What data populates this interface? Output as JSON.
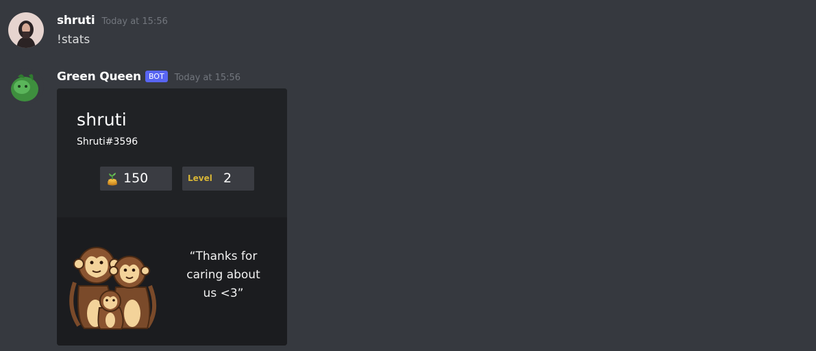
{
  "messages": [
    {
      "author": "shruti",
      "timestamp": "Today at 15:56",
      "content": "!stats"
    },
    {
      "author": "Green Queen",
      "bot_tag": "BOT",
      "timestamp": "Today at 15:56",
      "embed": {
        "name": "shruti",
        "tag": "Shruti#3596",
        "coins": "150",
        "level_label": "Level",
        "level": "2",
        "quote": "“Thanks for caring about us <3”"
      }
    }
  ],
  "icons": {
    "coin": "sprout-coins-icon",
    "mascot": "monkey-family-illustration"
  },
  "colors": {
    "background": "#36393f",
    "bot_tag": "#5865f2",
    "level_label": "#d8b636"
  }
}
